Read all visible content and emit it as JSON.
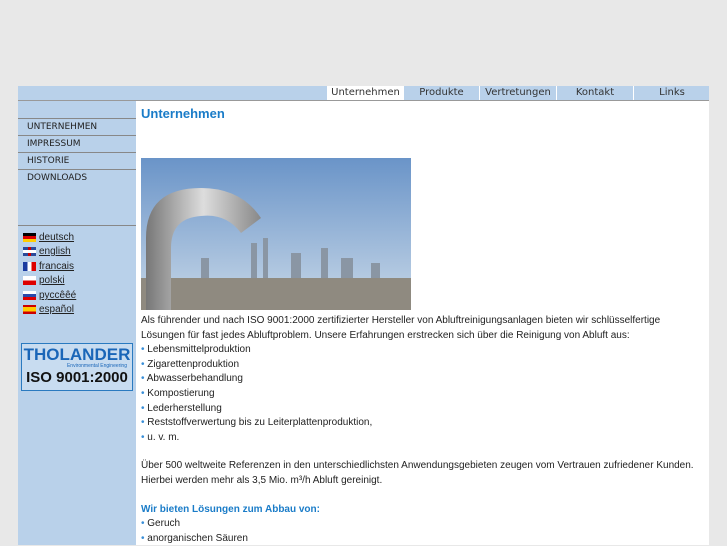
{
  "tabs": [
    "Unternehmen",
    "Produkte",
    "Vertretungen",
    "Kontakt",
    "Links"
  ],
  "sidebar": {
    "nav": [
      "UNTERNEHMEN",
      "IMPRESSUM",
      "HISTORIE",
      "DOWNLOADS"
    ],
    "languages": [
      "deutsch",
      "english",
      "francais",
      "polski",
      "pyccêêé",
      "español"
    ],
    "logo": {
      "brand": "THOLANDER",
      "tagline": "Environmental Engineering",
      "cert": "ISO 9001:2000"
    }
  },
  "main": {
    "title": "Unternehmen",
    "intro": "Als führender und nach ISO 9001:2000 zertifizierter Hersteller von Abluftreinigungsanlagen bieten wir schlüsselfertige Lösungen für fast jedes Abluftproblem. Unsere Erfahrungen erstrecken sich über die Reinigung von Abluft aus:",
    "industries": [
      "Lebensmittelproduktion",
      "Zigarettenproduktion",
      "Abwasserbehandlung",
      "Kompostierung",
      "Lederherstellung",
      "Reststoffverwertung bis zu Leiterplattenproduktion,",
      "u. v. m."
    ],
    "references": "Über 500 weltweite Referenzen in den unterschiedlichsten Anwendungsgebieten zeugen vom Vertrauen zufriedener Kunden. Hierbei werden mehr als 3,5 Mio. m³/h Abluft gereinigt.",
    "solutions_heading": "Wir bieten Lösungen zum Abbau von:",
    "solutions": [
      "Geruch",
      "anorganischen Säuren"
    ]
  },
  "colors": {
    "accent": "#1a7cc8",
    "nav_bg": "#b9d1ea"
  }
}
